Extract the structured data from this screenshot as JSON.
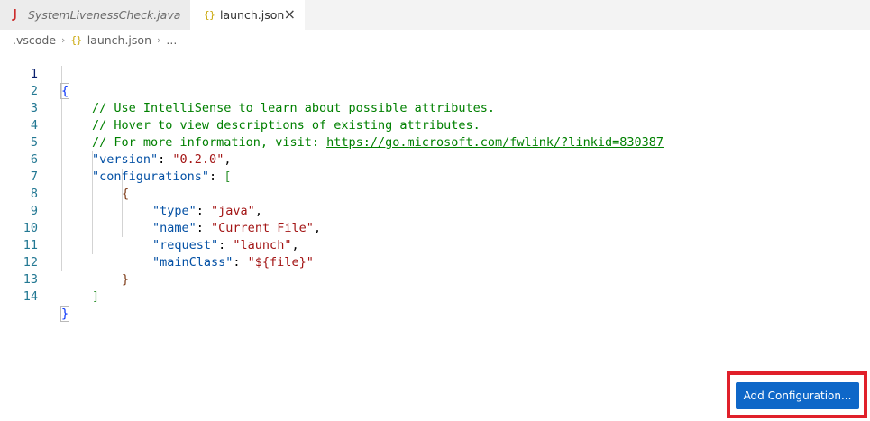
{
  "tabs": [
    {
      "icon": "J",
      "label": "SystemLivenessCheck.java",
      "active": false
    },
    {
      "icon": "{}",
      "label": "launch.json",
      "active": true,
      "close": "×"
    }
  ],
  "breadcrumb": {
    "folder": ".vscode",
    "file": "launch.json",
    "more": "...",
    "separator": "›",
    "file_icon": "{}"
  },
  "editor": {
    "line_numbers": [
      "1",
      "2",
      "3",
      "4",
      "5",
      "6",
      "7",
      "8",
      "9",
      "10",
      "11",
      "12",
      "13",
      "14"
    ],
    "lines": {
      "l1_brace": "{",
      "l2_comment": "// Use IntelliSense to learn about possible attributes.",
      "l3_comment": "// Hover to view descriptions of existing attributes.",
      "l4_comment": "// For more information, visit: ",
      "l4_link": "https://go.microsoft.com/fwlink/?linkid=830387",
      "l5_key": "\"version\"",
      "l5_colon": ": ",
      "l5_value": "\"0.2.0\"",
      "l5_comma": ",",
      "l6_key": "\"configurations\"",
      "l6_colon": ": ",
      "l6_bracket": "[",
      "l7_brace": "{",
      "l8_key": "\"type\"",
      "l8_colon": ": ",
      "l8_value": "\"java\"",
      "l8_comma": ",",
      "l9_key": "\"name\"",
      "l9_colon": ": ",
      "l9_value": "\"Current File\"",
      "l9_comma": ",",
      "l10_key": "\"request\"",
      "l10_colon": ": ",
      "l10_value": "\"launch\"",
      "l10_comma": ",",
      "l11_key": "\"mainClass\"",
      "l11_colon": ": ",
      "l11_value": "\"${file}\"",
      "l12_brace": "}",
      "l13_bracket": "]",
      "l14_brace": "}"
    }
  },
  "add_configuration_button": "Add Configuration...",
  "colors": {
    "accent_button": "#0e67c8",
    "highlight_border": "#e0202a",
    "comment": "#008000",
    "json_key": "#0451a5",
    "json_string": "#a31515"
  }
}
